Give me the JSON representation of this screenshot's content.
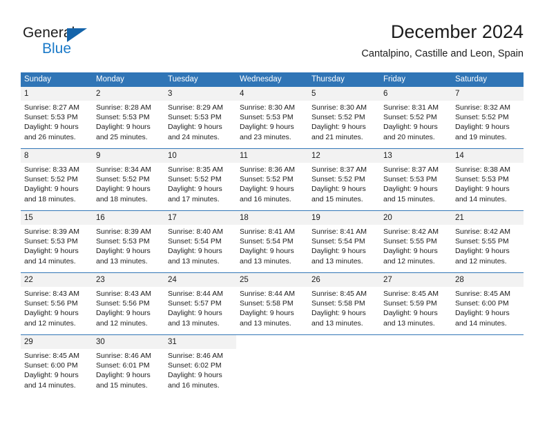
{
  "logo": {
    "word_top": "General",
    "word_bottom": "Blue",
    "triangle_color": "#1464aa",
    "blue_text_color": "#1a79c8"
  },
  "header": {
    "title": "December 2024",
    "subtitle": "Cantalpino, Castille and Leon, Spain"
  },
  "theme": {
    "header_bg": "#3075b6",
    "header_text": "#ffffff",
    "daynum_bg": "#f2f2f2",
    "grid_line": "#3075b6"
  },
  "calendar": {
    "weekday_headers": [
      "Sunday",
      "Monday",
      "Tuesday",
      "Wednesday",
      "Thursday",
      "Friday",
      "Saturday"
    ],
    "weeks": [
      [
        {
          "day": "1",
          "sunrise": "Sunrise: 8:27 AM",
          "sunset": "Sunset: 5:53 PM",
          "daylight_1": "Daylight: 9 hours",
          "daylight_2": "and 26 minutes."
        },
        {
          "day": "2",
          "sunrise": "Sunrise: 8:28 AM",
          "sunset": "Sunset: 5:53 PM",
          "daylight_1": "Daylight: 9 hours",
          "daylight_2": "and 25 minutes."
        },
        {
          "day": "3",
          "sunrise": "Sunrise: 8:29 AM",
          "sunset": "Sunset: 5:53 PM",
          "daylight_1": "Daylight: 9 hours",
          "daylight_2": "and 24 minutes."
        },
        {
          "day": "4",
          "sunrise": "Sunrise: 8:30 AM",
          "sunset": "Sunset: 5:53 PM",
          "daylight_1": "Daylight: 9 hours",
          "daylight_2": "and 23 minutes."
        },
        {
          "day": "5",
          "sunrise": "Sunrise: 8:30 AM",
          "sunset": "Sunset: 5:52 PM",
          "daylight_1": "Daylight: 9 hours",
          "daylight_2": "and 21 minutes."
        },
        {
          "day": "6",
          "sunrise": "Sunrise: 8:31 AM",
          "sunset": "Sunset: 5:52 PM",
          "daylight_1": "Daylight: 9 hours",
          "daylight_2": "and 20 minutes."
        },
        {
          "day": "7",
          "sunrise": "Sunrise: 8:32 AM",
          "sunset": "Sunset: 5:52 PM",
          "daylight_1": "Daylight: 9 hours",
          "daylight_2": "and 19 minutes."
        }
      ],
      [
        {
          "day": "8",
          "sunrise": "Sunrise: 8:33 AM",
          "sunset": "Sunset: 5:52 PM",
          "daylight_1": "Daylight: 9 hours",
          "daylight_2": "and 18 minutes."
        },
        {
          "day": "9",
          "sunrise": "Sunrise: 8:34 AM",
          "sunset": "Sunset: 5:52 PM",
          "daylight_1": "Daylight: 9 hours",
          "daylight_2": "and 18 minutes."
        },
        {
          "day": "10",
          "sunrise": "Sunrise: 8:35 AM",
          "sunset": "Sunset: 5:52 PM",
          "daylight_1": "Daylight: 9 hours",
          "daylight_2": "and 17 minutes."
        },
        {
          "day": "11",
          "sunrise": "Sunrise: 8:36 AM",
          "sunset": "Sunset: 5:52 PM",
          "daylight_1": "Daylight: 9 hours",
          "daylight_2": "and 16 minutes."
        },
        {
          "day": "12",
          "sunrise": "Sunrise: 8:37 AM",
          "sunset": "Sunset: 5:52 PM",
          "daylight_1": "Daylight: 9 hours",
          "daylight_2": "and 15 minutes."
        },
        {
          "day": "13",
          "sunrise": "Sunrise: 8:37 AM",
          "sunset": "Sunset: 5:53 PM",
          "daylight_1": "Daylight: 9 hours",
          "daylight_2": "and 15 minutes."
        },
        {
          "day": "14",
          "sunrise": "Sunrise: 8:38 AM",
          "sunset": "Sunset: 5:53 PM",
          "daylight_1": "Daylight: 9 hours",
          "daylight_2": "and 14 minutes."
        }
      ],
      [
        {
          "day": "15",
          "sunrise": "Sunrise: 8:39 AM",
          "sunset": "Sunset: 5:53 PM",
          "daylight_1": "Daylight: 9 hours",
          "daylight_2": "and 14 minutes."
        },
        {
          "day": "16",
          "sunrise": "Sunrise: 8:39 AM",
          "sunset": "Sunset: 5:53 PM",
          "daylight_1": "Daylight: 9 hours",
          "daylight_2": "and 13 minutes."
        },
        {
          "day": "17",
          "sunrise": "Sunrise: 8:40 AM",
          "sunset": "Sunset: 5:54 PM",
          "daylight_1": "Daylight: 9 hours",
          "daylight_2": "and 13 minutes."
        },
        {
          "day": "18",
          "sunrise": "Sunrise: 8:41 AM",
          "sunset": "Sunset: 5:54 PM",
          "daylight_1": "Daylight: 9 hours",
          "daylight_2": "and 13 minutes."
        },
        {
          "day": "19",
          "sunrise": "Sunrise: 8:41 AM",
          "sunset": "Sunset: 5:54 PM",
          "daylight_1": "Daylight: 9 hours",
          "daylight_2": "and 13 minutes."
        },
        {
          "day": "20",
          "sunrise": "Sunrise: 8:42 AM",
          "sunset": "Sunset: 5:55 PM",
          "daylight_1": "Daylight: 9 hours",
          "daylight_2": "and 12 minutes."
        },
        {
          "day": "21",
          "sunrise": "Sunrise: 8:42 AM",
          "sunset": "Sunset: 5:55 PM",
          "daylight_1": "Daylight: 9 hours",
          "daylight_2": "and 12 minutes."
        }
      ],
      [
        {
          "day": "22",
          "sunrise": "Sunrise: 8:43 AM",
          "sunset": "Sunset: 5:56 PM",
          "daylight_1": "Daylight: 9 hours",
          "daylight_2": "and 12 minutes."
        },
        {
          "day": "23",
          "sunrise": "Sunrise: 8:43 AM",
          "sunset": "Sunset: 5:56 PM",
          "daylight_1": "Daylight: 9 hours",
          "daylight_2": "and 12 minutes."
        },
        {
          "day": "24",
          "sunrise": "Sunrise: 8:44 AM",
          "sunset": "Sunset: 5:57 PM",
          "daylight_1": "Daylight: 9 hours",
          "daylight_2": "and 13 minutes."
        },
        {
          "day": "25",
          "sunrise": "Sunrise: 8:44 AM",
          "sunset": "Sunset: 5:58 PM",
          "daylight_1": "Daylight: 9 hours",
          "daylight_2": "and 13 minutes."
        },
        {
          "day": "26",
          "sunrise": "Sunrise: 8:45 AM",
          "sunset": "Sunset: 5:58 PM",
          "daylight_1": "Daylight: 9 hours",
          "daylight_2": "and 13 minutes."
        },
        {
          "day": "27",
          "sunrise": "Sunrise: 8:45 AM",
          "sunset": "Sunset: 5:59 PM",
          "daylight_1": "Daylight: 9 hours",
          "daylight_2": "and 13 minutes."
        },
        {
          "day": "28",
          "sunrise": "Sunrise: 8:45 AM",
          "sunset": "Sunset: 6:00 PM",
          "daylight_1": "Daylight: 9 hours",
          "daylight_2": "and 14 minutes."
        }
      ],
      [
        {
          "day": "29",
          "sunrise": "Sunrise: 8:45 AM",
          "sunset": "Sunset: 6:00 PM",
          "daylight_1": "Daylight: 9 hours",
          "daylight_2": "and 14 minutes."
        },
        {
          "day": "30",
          "sunrise": "Sunrise: 8:46 AM",
          "sunset": "Sunset: 6:01 PM",
          "daylight_1": "Daylight: 9 hours",
          "daylight_2": "and 15 minutes."
        },
        {
          "day": "31",
          "sunrise": "Sunrise: 8:46 AM",
          "sunset": "Sunset: 6:02 PM",
          "daylight_1": "Daylight: 9 hours",
          "daylight_2": "and 16 minutes."
        },
        {
          "day": "",
          "sunrise": "",
          "sunset": "",
          "daylight_1": "",
          "daylight_2": ""
        },
        {
          "day": "",
          "sunrise": "",
          "sunset": "",
          "daylight_1": "",
          "daylight_2": ""
        },
        {
          "day": "",
          "sunrise": "",
          "sunset": "",
          "daylight_1": "",
          "daylight_2": ""
        },
        {
          "day": "",
          "sunrise": "",
          "sunset": "",
          "daylight_1": "",
          "daylight_2": ""
        }
      ]
    ]
  }
}
